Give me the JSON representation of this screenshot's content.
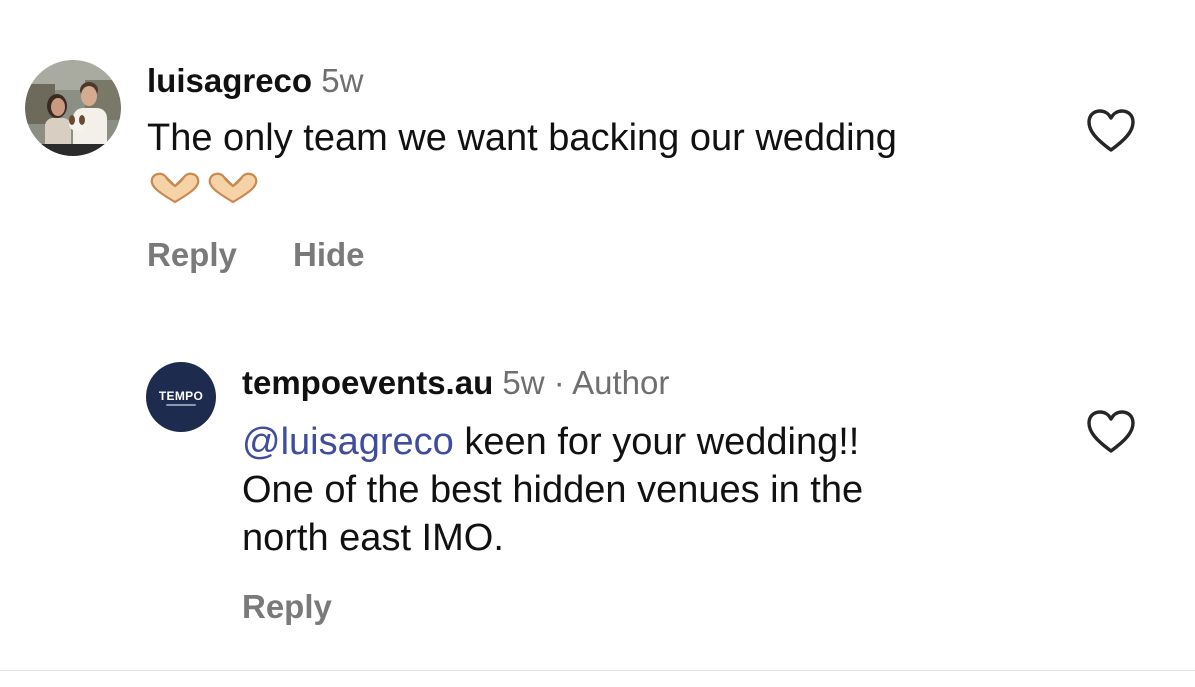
{
  "comments": [
    {
      "username": "luisagreco",
      "time": "5w",
      "text": "The only team we want backing our wedding",
      "emoji_icons": [
        "heart-hands-icon",
        "heart-hands-icon"
      ],
      "actions": {
        "reply": "Reply",
        "hide": "Hide"
      },
      "like_icon": "heart-outline-icon"
    },
    {
      "username": "tempoevents.au",
      "time": "5w",
      "separator": "·",
      "author_tag": "Author",
      "avatar_text": "TEMPO",
      "mention": "@luisagreco",
      "text_line1": " keen for your wedding!!",
      "text_line2": "One of the best hidden venues in the",
      "text_line3": "north east IMO.",
      "actions": {
        "reply": "Reply"
      },
      "like_icon": "heart-outline-icon"
    }
  ],
  "colors": {
    "mention": "#404c9e",
    "muted": "#7a7a7a",
    "logo_bg": "#1d2b4e"
  }
}
